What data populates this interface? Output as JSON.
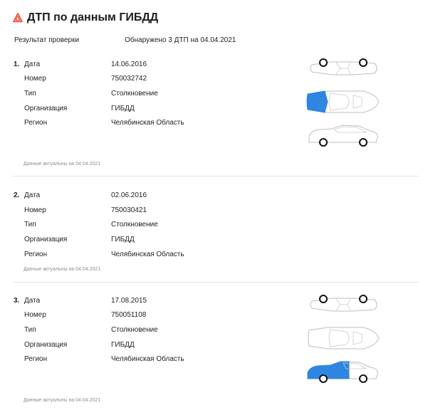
{
  "header": {
    "title": "ДТП по данным ГИБДД",
    "icon": "warning-triangle-icon",
    "icon_color": "#e8452c"
  },
  "summary": {
    "label": "Результат проверки",
    "value": "Обнаружено 3 ДТП на 04.04.2021"
  },
  "labels": {
    "date": "Дата",
    "number": "Номер",
    "type": "Тип",
    "org": "Организация",
    "region": "Регион"
  },
  "damage_color": "#2f86e0",
  "accidents": [
    {
      "index": "1.",
      "date": "14.06.2016",
      "number": "750032742",
      "type": "Столкновение",
      "org": "ГИБДД",
      "region": "Челябинская Область",
      "updated": "Данные актуальны на 04.04.2021",
      "damage": [
        "top-front"
      ]
    },
    {
      "index": "2.",
      "date": "02.06.2016",
      "number": "750030421",
      "type": "Столкновение",
      "org": "ГИБДД",
      "region": "Челябинская Область",
      "updated": "Данные актуальны на 04.04.2021",
      "damage": []
    },
    {
      "index": "3.",
      "date": "17.08.2015",
      "number": "750051108",
      "type": "Столкновение",
      "org": "ГИБДД",
      "region": "Челябинская Область",
      "updated": "Данные актуальны на 04.04.2021",
      "damage": [
        "side-rear"
      ]
    }
  ]
}
